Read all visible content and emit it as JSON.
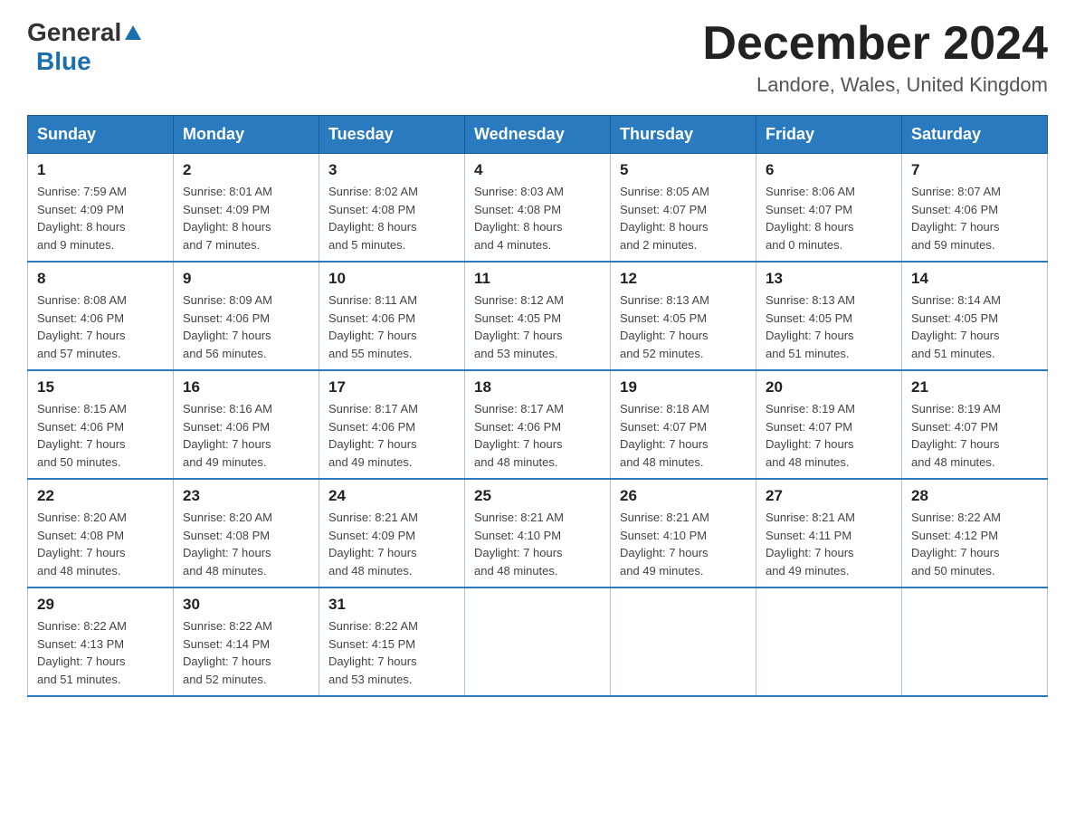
{
  "header": {
    "logo_general": "General",
    "logo_blue": "Blue",
    "month_title": "December 2024",
    "location": "Landore, Wales, United Kingdom"
  },
  "days_of_week": [
    "Sunday",
    "Monday",
    "Tuesday",
    "Wednesday",
    "Thursday",
    "Friday",
    "Saturday"
  ],
  "weeks": [
    [
      {
        "day": "1",
        "info": "Sunrise: 7:59 AM\nSunset: 4:09 PM\nDaylight: 8 hours\nand 9 minutes."
      },
      {
        "day": "2",
        "info": "Sunrise: 8:01 AM\nSunset: 4:09 PM\nDaylight: 8 hours\nand 7 minutes."
      },
      {
        "day": "3",
        "info": "Sunrise: 8:02 AM\nSunset: 4:08 PM\nDaylight: 8 hours\nand 5 minutes."
      },
      {
        "day": "4",
        "info": "Sunrise: 8:03 AM\nSunset: 4:08 PM\nDaylight: 8 hours\nand 4 minutes."
      },
      {
        "day": "5",
        "info": "Sunrise: 8:05 AM\nSunset: 4:07 PM\nDaylight: 8 hours\nand 2 minutes."
      },
      {
        "day": "6",
        "info": "Sunrise: 8:06 AM\nSunset: 4:07 PM\nDaylight: 8 hours\nand 0 minutes."
      },
      {
        "day": "7",
        "info": "Sunrise: 8:07 AM\nSunset: 4:06 PM\nDaylight: 7 hours\nand 59 minutes."
      }
    ],
    [
      {
        "day": "8",
        "info": "Sunrise: 8:08 AM\nSunset: 4:06 PM\nDaylight: 7 hours\nand 57 minutes."
      },
      {
        "day": "9",
        "info": "Sunrise: 8:09 AM\nSunset: 4:06 PM\nDaylight: 7 hours\nand 56 minutes."
      },
      {
        "day": "10",
        "info": "Sunrise: 8:11 AM\nSunset: 4:06 PM\nDaylight: 7 hours\nand 55 minutes."
      },
      {
        "day": "11",
        "info": "Sunrise: 8:12 AM\nSunset: 4:05 PM\nDaylight: 7 hours\nand 53 minutes."
      },
      {
        "day": "12",
        "info": "Sunrise: 8:13 AM\nSunset: 4:05 PM\nDaylight: 7 hours\nand 52 minutes."
      },
      {
        "day": "13",
        "info": "Sunrise: 8:13 AM\nSunset: 4:05 PM\nDaylight: 7 hours\nand 51 minutes."
      },
      {
        "day": "14",
        "info": "Sunrise: 8:14 AM\nSunset: 4:05 PM\nDaylight: 7 hours\nand 51 minutes."
      }
    ],
    [
      {
        "day": "15",
        "info": "Sunrise: 8:15 AM\nSunset: 4:06 PM\nDaylight: 7 hours\nand 50 minutes."
      },
      {
        "day": "16",
        "info": "Sunrise: 8:16 AM\nSunset: 4:06 PM\nDaylight: 7 hours\nand 49 minutes."
      },
      {
        "day": "17",
        "info": "Sunrise: 8:17 AM\nSunset: 4:06 PM\nDaylight: 7 hours\nand 49 minutes."
      },
      {
        "day": "18",
        "info": "Sunrise: 8:17 AM\nSunset: 4:06 PM\nDaylight: 7 hours\nand 48 minutes."
      },
      {
        "day": "19",
        "info": "Sunrise: 8:18 AM\nSunset: 4:07 PM\nDaylight: 7 hours\nand 48 minutes."
      },
      {
        "day": "20",
        "info": "Sunrise: 8:19 AM\nSunset: 4:07 PM\nDaylight: 7 hours\nand 48 minutes."
      },
      {
        "day": "21",
        "info": "Sunrise: 8:19 AM\nSunset: 4:07 PM\nDaylight: 7 hours\nand 48 minutes."
      }
    ],
    [
      {
        "day": "22",
        "info": "Sunrise: 8:20 AM\nSunset: 4:08 PM\nDaylight: 7 hours\nand 48 minutes."
      },
      {
        "day": "23",
        "info": "Sunrise: 8:20 AM\nSunset: 4:08 PM\nDaylight: 7 hours\nand 48 minutes."
      },
      {
        "day": "24",
        "info": "Sunrise: 8:21 AM\nSunset: 4:09 PM\nDaylight: 7 hours\nand 48 minutes."
      },
      {
        "day": "25",
        "info": "Sunrise: 8:21 AM\nSunset: 4:10 PM\nDaylight: 7 hours\nand 48 minutes."
      },
      {
        "day": "26",
        "info": "Sunrise: 8:21 AM\nSunset: 4:10 PM\nDaylight: 7 hours\nand 49 minutes."
      },
      {
        "day": "27",
        "info": "Sunrise: 8:21 AM\nSunset: 4:11 PM\nDaylight: 7 hours\nand 49 minutes."
      },
      {
        "day": "28",
        "info": "Sunrise: 8:22 AM\nSunset: 4:12 PM\nDaylight: 7 hours\nand 50 minutes."
      }
    ],
    [
      {
        "day": "29",
        "info": "Sunrise: 8:22 AM\nSunset: 4:13 PM\nDaylight: 7 hours\nand 51 minutes."
      },
      {
        "day": "30",
        "info": "Sunrise: 8:22 AM\nSunset: 4:14 PM\nDaylight: 7 hours\nand 52 minutes."
      },
      {
        "day": "31",
        "info": "Sunrise: 8:22 AM\nSunset: 4:15 PM\nDaylight: 7 hours\nand 53 minutes."
      },
      null,
      null,
      null,
      null
    ]
  ]
}
